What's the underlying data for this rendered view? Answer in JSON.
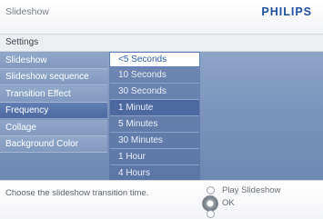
{
  "header": {
    "title": "Slideshow",
    "brand": "PHILIPS"
  },
  "breadcrumb": {
    "settings": "Settings"
  },
  "menu": {
    "items": [
      {
        "label": "Slideshow"
      },
      {
        "label": "Slideshow sequence"
      },
      {
        "label": "Transition Effect"
      },
      {
        "label": "Frequency"
      },
      {
        "label": "Collage"
      },
      {
        "label": "Background Color"
      }
    ],
    "active_index": 3
  },
  "options": {
    "items": [
      {
        "label": "<5 Seconds"
      },
      {
        "label": "10 Seconds"
      },
      {
        "label": "30 Seconds"
      },
      {
        "label": "1 Minute"
      },
      {
        "label": "5 Minutes"
      },
      {
        "label": "30 Minutes"
      },
      {
        "label": "1 Hour"
      },
      {
        "label": "4 Hours"
      }
    ],
    "selected_index": 0,
    "highlight_index": 3
  },
  "footer": {
    "hint": "Choose the slideshow transition time.",
    "play_label": "Play Slideshow",
    "ok_label": "OK"
  },
  "colors": {
    "brand": "#1f4fa0",
    "panel": "#7b93bc",
    "active_item": "#4c6aa0",
    "selected_option_text": "#2f5ea6"
  },
  "icons": {
    "nav_up": "nav-up-dot",
    "nav_ok": "ok-button",
    "nav_down": "nav-down-dot"
  }
}
